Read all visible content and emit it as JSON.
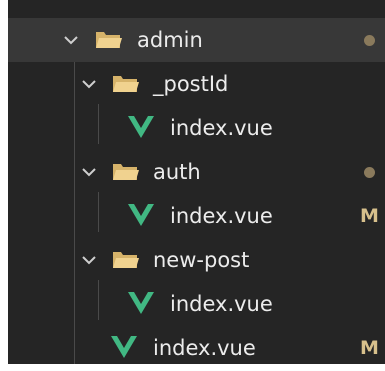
{
  "colors": {
    "background": "#252525",
    "selected_row": "#383838",
    "text": "#ececec",
    "folder": "#e6c47a",
    "vue_green": "#41b883",
    "vue_dark": "#34495e",
    "dot": "#8a7a5c",
    "badge": "#d7c08c",
    "chevron": "#cfcfcf"
  },
  "tree": {
    "admin": {
      "label": "admin",
      "icon": "folder-open-icon",
      "state": "expanded",
      "modified_dot": true
    },
    "postId": {
      "label": "_postId",
      "icon": "folder-open-icon",
      "state": "expanded"
    },
    "postId_index": {
      "label": "index.vue",
      "icon": "vue-icon"
    },
    "auth": {
      "label": "auth",
      "icon": "folder-open-icon",
      "state": "expanded",
      "modified_dot": true
    },
    "auth_index": {
      "label": "index.vue",
      "icon": "vue-icon",
      "badge": "M"
    },
    "new_post": {
      "label": "new-post",
      "icon": "folder-open-icon",
      "state": "expanded"
    },
    "new_post_index": {
      "label": "index.vue",
      "icon": "vue-icon"
    },
    "admin_index": {
      "label": "index.vue",
      "icon": "vue-icon",
      "badge": "M"
    }
  }
}
